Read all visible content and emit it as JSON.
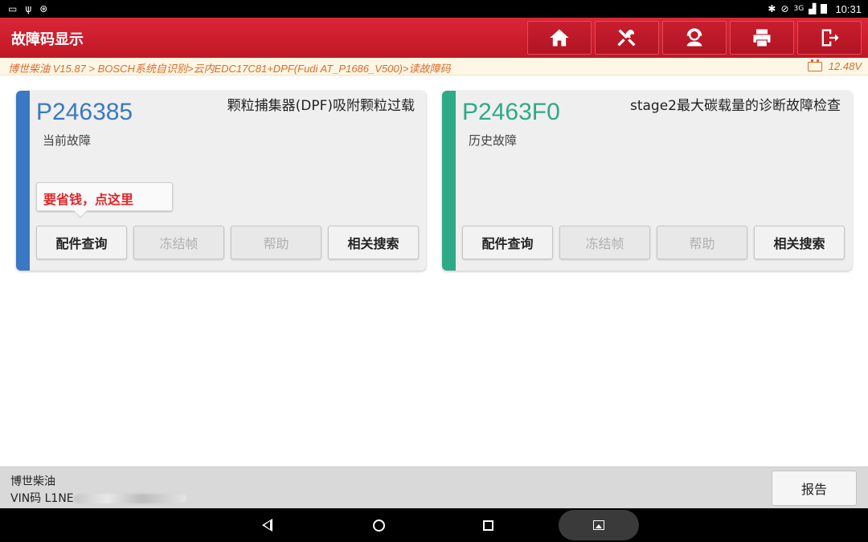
{
  "status_bar": {
    "time": "10:31",
    "network": "3G"
  },
  "header": {
    "title": "故障码显示"
  },
  "toolbar": {
    "buttons": [
      {
        "name": "home",
        "icon": "home-icon"
      },
      {
        "name": "tools",
        "icon": "wrench-screwdriver-icon"
      },
      {
        "name": "support",
        "icon": "user-headset-icon"
      },
      {
        "name": "print",
        "icon": "printer-icon"
      },
      {
        "name": "exit",
        "icon": "exit-icon"
      }
    ]
  },
  "breadcrumb": {
    "path": "博世柴油 V15.87 > BOSCH系统自识别>云内EDC17C81+DPF(Fudi AT_P1686_V500)>读故障码",
    "voltage": "12.48V"
  },
  "faults": [
    {
      "code": "P246385",
      "description": "颗粒捕集器(DPF)吸附颗粒过载",
      "state": "当前故障",
      "accent": "#3a78c4",
      "promo": "要省钱，点这里",
      "actions": [
        "配件查询",
        "冻结帧",
        "帮助",
        "相关搜索"
      ]
    },
    {
      "code": "P2463F0",
      "description": "stage2最大碳载量的诊断故障检查",
      "state": "历史故障",
      "accent": "#2eaa86",
      "actions": [
        "配件查询",
        "冻结帧",
        "帮助",
        "相关搜索"
      ]
    }
  ],
  "footer": {
    "brand": "博世柴油",
    "vin_label": "VIN码 L1NE",
    "report_label": "报告"
  },
  "colors": {
    "header_red": "#c8202f",
    "crumb_orange": "#e06a2a",
    "code_blue": "#3a78c4",
    "code_green": "#2eaa86"
  }
}
